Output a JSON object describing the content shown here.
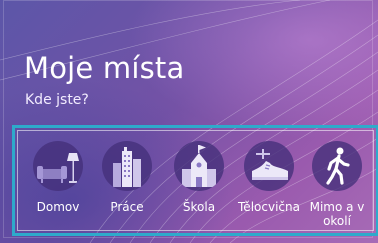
{
  "header": {
    "title": "Moje místa",
    "subtitle": "Kde jste?"
  },
  "places": [
    {
      "label": "Domov",
      "icon": "home-icon"
    },
    {
      "label": "Práce",
      "icon": "office-building-icon"
    },
    {
      "label": "Škola",
      "icon": "school-icon"
    },
    {
      "label": "Tělocvična",
      "icon": "sneaker-icon"
    },
    {
      "label": "Mimo a v okolí",
      "icon": "walking-person-icon"
    }
  ],
  "colors": {
    "accent": "#2eaacb",
    "tile_circle": "#44307a",
    "background_start": "#5c56a8",
    "background_end": "#a76bb6"
  }
}
